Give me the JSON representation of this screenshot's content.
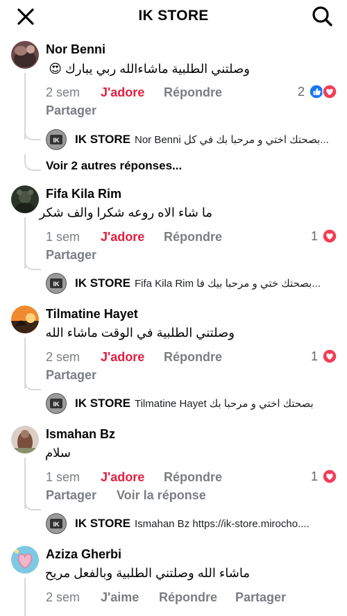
{
  "header": {
    "title": "IK STORE",
    "close_icon": "close-icon",
    "search_icon": "search-icon"
  },
  "labels": {
    "like": "J'adore",
    "like_plain": "J'aime",
    "reply": "Répondre",
    "share": "Partager"
  },
  "colors": {
    "liked": "#e41e3f",
    "muted": "#7a7d82",
    "thread_line": "#d6d9dd",
    "fb_blue": "#1877f2",
    "heart": "#f33e58"
  },
  "comments": [
    {
      "author": "Nor Benni",
      "text": "وصلتني الطلبية ماشاءالله ربي يبارك 😍",
      "time": "2 sem",
      "reaction_count": "2",
      "reply": {
        "author": "IK STORE",
        "text": "Nor Benni بصحتك اختي و مرحبا بك في كل..."
      },
      "more_replies": "Voir 2 autres réponses..."
    },
    {
      "author": "Fifa Kila Rim",
      "text": "ما شاء الاه روعه شكرا والف شكر",
      "time": "1 sem",
      "reaction_count": "1",
      "reply": {
        "author": "IK STORE",
        "text": "Fifa Kila Rim بصحتك ختي و مرحبا بيك فا..."
      }
    },
    {
      "author": "Tilmatine Hayet",
      "text": "وصلتني الطلبية في الوقت ماشاء الله",
      "time": "2 sem",
      "reaction_count": "1",
      "reply": {
        "author": "IK STORE",
        "text": "Tilmatine Hayet بصحتك اختي و مرحبا بك"
      }
    },
    {
      "author": "Ismahan Bz",
      "text": "سلام",
      "time": "1 sem",
      "reaction_count": "1",
      "see_reply": "Voir la réponse",
      "reply": {
        "author": "IK STORE",
        "text": "Ismahan Bz https://ik-store.mirocho...."
      }
    },
    {
      "author": "Aziza Gherbi",
      "text": "ماشاء الله وصلتني الطلبية وبالفعل مريح",
      "time": "2 sem"
    }
  ]
}
